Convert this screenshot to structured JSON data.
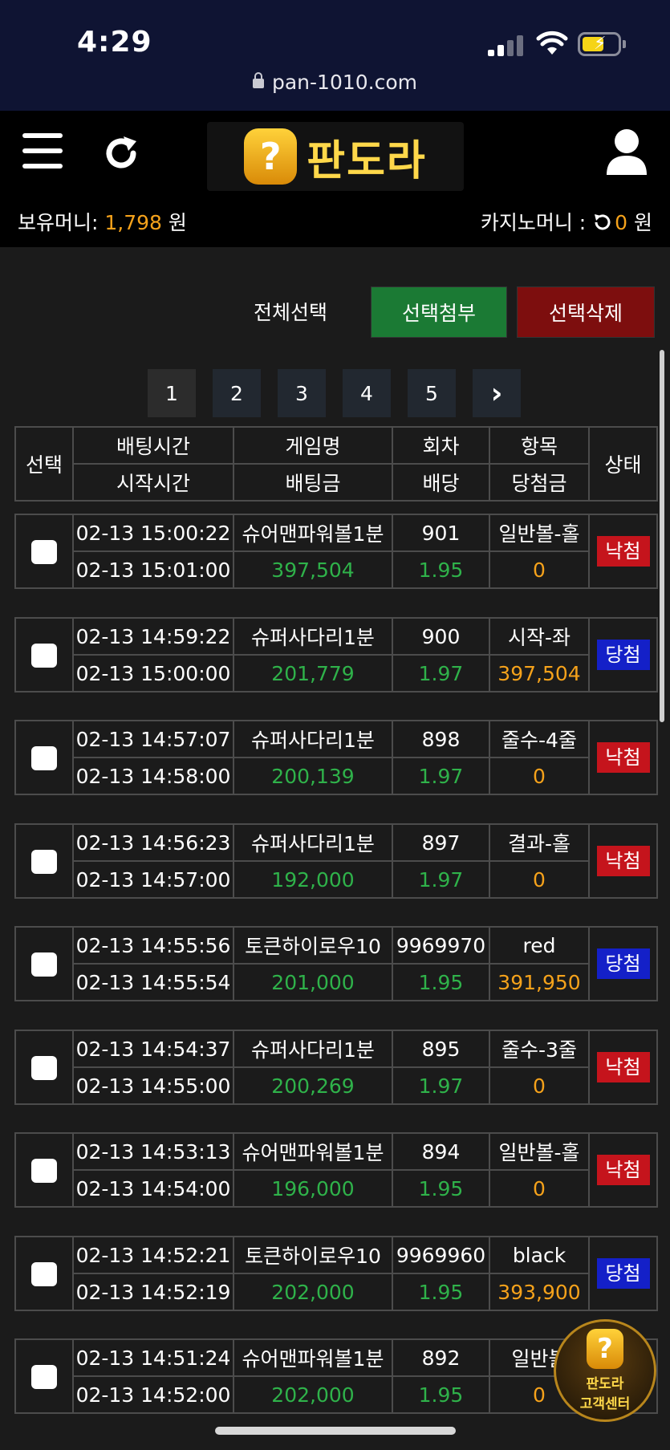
{
  "status": {
    "time": "4:29",
    "url": "pan-1010.com"
  },
  "header": {
    "logo_text": "판도라",
    "logo_badge": "?",
    "balance_label": "보유머니: ",
    "balance_value": "1,798",
    "balance_unit": " 원",
    "casino_label": "카지노머니 : ",
    "casino_value": "0",
    "casino_unit": " 원"
  },
  "actions": {
    "select_all": "전체선택",
    "attach": "선택첨부",
    "delete": "선택삭제"
  },
  "pager": {
    "pages": [
      "1",
      "2",
      "3",
      "4",
      "5"
    ],
    "next": "›"
  },
  "table": {
    "h_select": "선택",
    "h_bet_time": "배팅시간",
    "h_game": "게임명",
    "h_round": "회차",
    "h_item": "항목",
    "h_state": "상태",
    "h_start_time": "시작시간",
    "h_bet_amount": "배팅금",
    "h_odds": "배당",
    "h_win_amount": "당첨금",
    "rows": [
      {
        "bet_time": "02-13 15:00:22",
        "start_time": "02-13 15:01:00",
        "game": "슈어맨파워볼1분",
        "amount": "397,504",
        "round": "901",
        "odds": "1.95",
        "item": "일반볼-홀",
        "win": "0",
        "state": "낙첨",
        "result": "lose"
      },
      {
        "bet_time": "02-13 14:59:22",
        "start_time": "02-13 15:00:00",
        "game": "슈퍼사다리1분",
        "amount": "201,779",
        "round": "900",
        "odds": "1.97",
        "item": "시작-좌",
        "win": "397,504",
        "state": "당첨",
        "result": "win"
      },
      {
        "bet_time": "02-13 14:57:07",
        "start_time": "02-13 14:58:00",
        "game": "슈퍼사다리1분",
        "amount": "200,139",
        "round": "898",
        "odds": "1.97",
        "item": "줄수-4줄",
        "win": "0",
        "state": "낙첨",
        "result": "lose"
      },
      {
        "bet_time": "02-13 14:56:23",
        "start_time": "02-13 14:57:00",
        "game": "슈퍼사다리1분",
        "amount": "192,000",
        "round": "897",
        "odds": "1.97",
        "item": "결과-홀",
        "win": "0",
        "state": "낙첨",
        "result": "lose"
      },
      {
        "bet_time": "02-13 14:55:56",
        "start_time": "02-13 14:55:54",
        "game": "토큰하이로우10",
        "amount": "201,000",
        "round": "9969970",
        "odds": "1.95",
        "item": "red",
        "win": "391,950",
        "state": "당첨",
        "result": "win"
      },
      {
        "bet_time": "02-13 14:54:37",
        "start_time": "02-13 14:55:00",
        "game": "슈퍼사다리1분",
        "amount": "200,269",
        "round": "895",
        "odds": "1.97",
        "item": "줄수-3줄",
        "win": "0",
        "state": "낙첨",
        "result": "lose"
      },
      {
        "bet_time": "02-13 14:53:13",
        "start_time": "02-13 14:54:00",
        "game": "슈어맨파워볼1분",
        "amount": "196,000",
        "round": "894",
        "odds": "1.95",
        "item": "일반볼-홀",
        "win": "0",
        "state": "낙첨",
        "result": "lose"
      },
      {
        "bet_time": "02-13 14:52:21",
        "start_time": "02-13 14:52:19",
        "game": "토큰하이로우10",
        "amount": "202,000",
        "round": "9969960",
        "odds": "1.95",
        "item": "black",
        "win": "393,900",
        "state": "당첨",
        "result": "win"
      },
      {
        "bet_time": "02-13 14:51:24",
        "start_time": "02-13 14:52:00",
        "game": "슈어맨파워볼1분",
        "amount": "202,000",
        "round": "892",
        "odds": "1.95",
        "item": "일반볼",
        "win": "0",
        "state": "",
        "result": "hidden"
      }
    ]
  },
  "cs_button": {
    "badge": "?",
    "line1": "판도라",
    "line2": "고객센터"
  },
  "colors": {
    "win_badge": "#1420c8",
    "lose_badge": "#c5141c",
    "amount": "#2fb24a",
    "highlight": "#f5a21b"
  }
}
